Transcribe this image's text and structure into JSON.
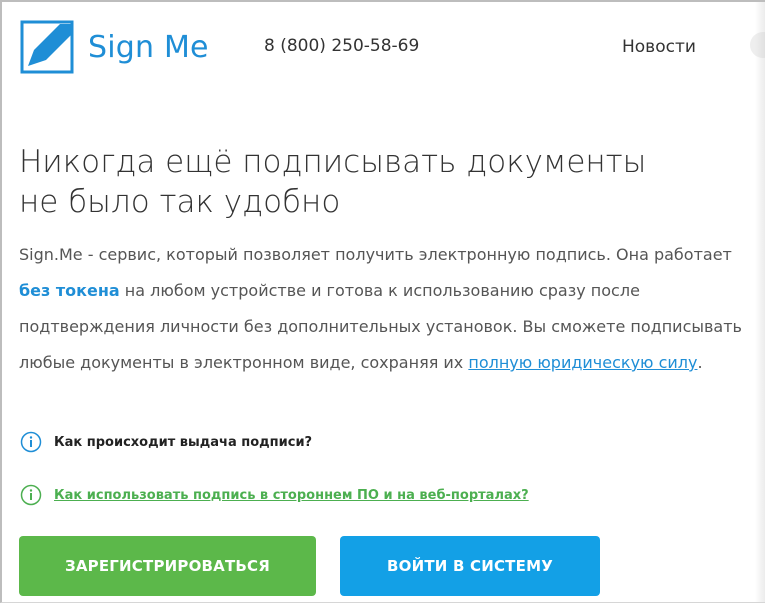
{
  "header": {
    "logo_text": "Sign Me",
    "phone": "8 (800) 250-58-69",
    "nav": {
      "news": "Новости"
    }
  },
  "main": {
    "headline_line1": "Никогда ещё подписывать документы",
    "headline_line2": "не было так удобно",
    "desc": {
      "part1": "Sign.Me - сервис, который позволяет получить электронную подпись. Она работает ",
      "bold_link": "без токена",
      "part2": " на любом устройстве и готова к использованию сразу после подтверждения личности без дополнительных установок. Вы сможете подписывать любые документы в электронном виде, сохраняя их ",
      "link": "полную юридическую силу",
      "part3": "."
    },
    "info": [
      {
        "text": "Как происходит выдача подписи?"
      },
      {
        "text": "Как использовать подпись в стороннем ПО и на веб-порталах?"
      }
    ],
    "buttons": {
      "register": "ЗАРЕГИСТРИРОВАТЬСЯ",
      "login": "ВОЙТИ В СИСТЕМУ"
    }
  },
  "colors": {
    "brand_blue": "#1f8ed6",
    "green_button": "#5cb84a",
    "blue_button": "#13a0e6",
    "green_link": "#4caf50"
  },
  "icons": [
    "pen-logo-icon",
    "info-icon"
  ]
}
